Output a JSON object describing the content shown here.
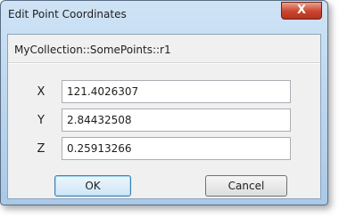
{
  "window": {
    "title": "Edit Point Coordinates",
    "close_label": "X"
  },
  "dialog": {
    "path": "MyCollection::SomePoints::r1",
    "fields": [
      {
        "label": "X",
        "value": "121.4026307"
      },
      {
        "label": "Y",
        "value": "2.84432508"
      },
      {
        "label": "Z",
        "value": "0.25913266"
      }
    ],
    "ok_label": "OK",
    "cancel_label": "Cancel"
  }
}
